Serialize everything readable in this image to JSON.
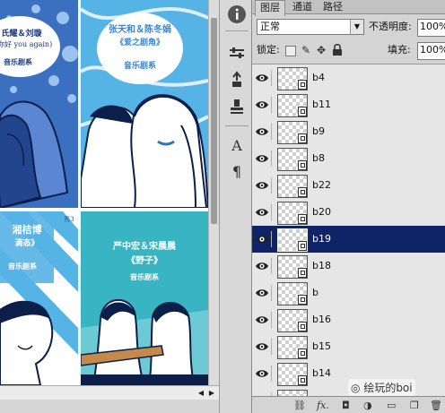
{
  "tabs": [
    {
      "label": "图层",
      "active": true
    },
    {
      "label": "通道",
      "active": false
    },
    {
      "label": "路径",
      "active": false
    }
  ],
  "blend_mode": "正常",
  "opacity_label": "不透明度:",
  "opacity_value": "100%",
  "lock_label": "锁定:",
  "fill_label": "填充:",
  "fill_value": "100%",
  "layers": [
    {
      "name": "b4",
      "selected": false
    },
    {
      "name": "b11",
      "selected": false
    },
    {
      "name": "b9",
      "selected": false
    },
    {
      "name": "b8",
      "selected": false
    },
    {
      "name": "b22",
      "selected": false
    },
    {
      "name": "b20",
      "selected": false
    },
    {
      "name": "b19",
      "selected": true
    },
    {
      "name": "b18",
      "selected": false
    },
    {
      "name": "b",
      "selected": false
    },
    {
      "name": "b16",
      "selected": false
    },
    {
      "name": "b15",
      "selected": false
    },
    {
      "name": "b14",
      "selected": false
    },
    {
      "name": "b13",
      "selected": false
    }
  ],
  "artwork": {
    "panel1_caption": "(你好 you again)",
    "panel1_sub": "音乐剧系",
    "panel1_title_partial": "氏耀＆刘璇",
    "panel2_title": "张天和＆陈冬娟",
    "panel2_subtitle": "《爱之剧角》",
    "panel2_sub": "音乐剧系",
    "panel3_title_partial": "湘桔博",
    "panel3_subtitle_partial": "滴态》",
    "panel3_sub": "音乐剧系",
    "panel3_num": "秀3",
    "panel4_title": "严中宏＆宋晨晨",
    "panel4_subtitle": "《野子》",
    "panel4_sub": "音乐剧系"
  },
  "watermark": "绘玩的boi",
  "colors": {
    "selection": "#0f2466",
    "blue_dark": "#3a6fc0",
    "blue_light": "#4fb2e4",
    "teal": "#2fa9b7"
  },
  "icons": [
    "info-icon",
    "brush-settings-icon",
    "clone-source-icon",
    "tool-presets-icon",
    "character-icon",
    "paragraph-icon",
    "eye-icon",
    "link-icon",
    "fx-icon",
    "mask-icon",
    "adjustment-icon",
    "group-icon",
    "new-layer-icon",
    "trash-icon"
  ]
}
